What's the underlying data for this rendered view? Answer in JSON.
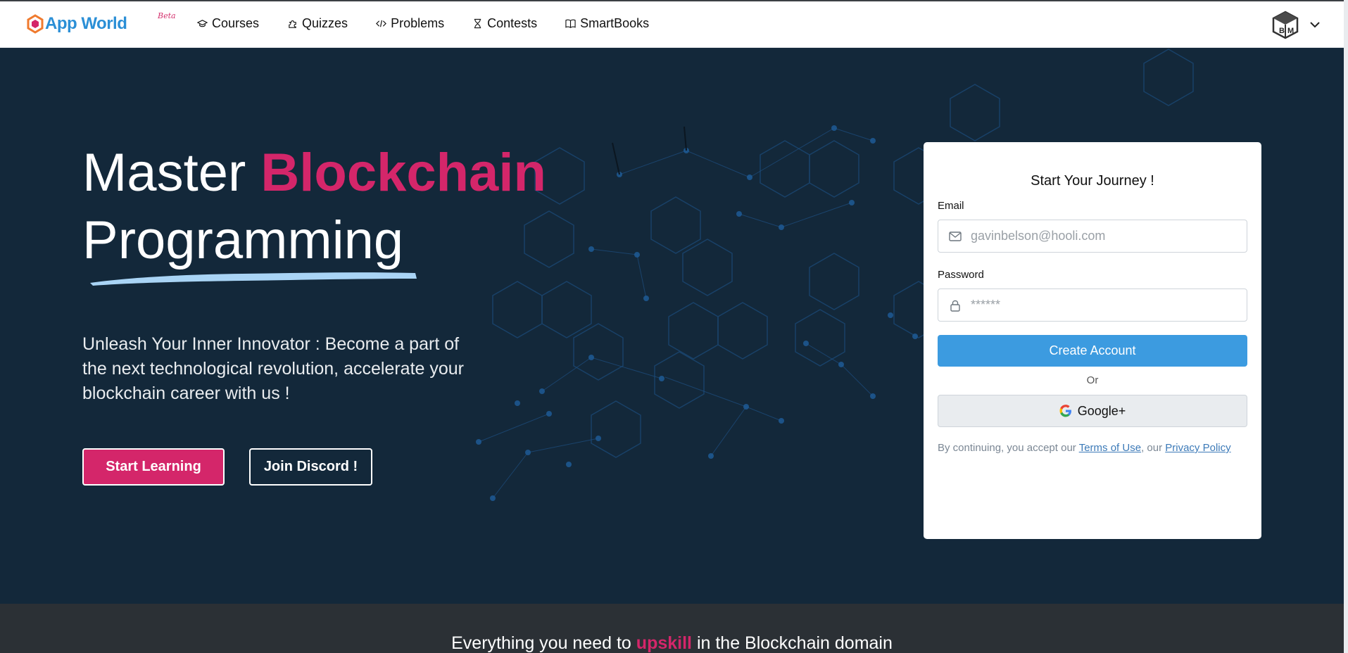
{
  "brand": {
    "name": "App World",
    "badge": "Beta",
    "accent": "#d4266a",
    "primary": "#3c9be0"
  },
  "nav": {
    "items": [
      {
        "label": "Courses",
        "icon": "graduation-cap-icon"
      },
      {
        "label": "Quizzes",
        "icon": "puzzle-icon"
      },
      {
        "label": "Problems",
        "icon": "code-icon"
      },
      {
        "label": "Contests",
        "icon": "hourglass-icon"
      },
      {
        "label": "SmartBooks",
        "icon": "book-icon"
      }
    ],
    "avatar_initials": "BM"
  },
  "hero": {
    "title_plain": "Master",
    "title_highlight": "Blockchain",
    "title_line2": "Programming",
    "subtitle": "Unleash Your Inner Innovator : Become a part of the next technological revolution, accelerate your blockchain career with us !",
    "primary_button": "Start Learning",
    "secondary_button": "Join Discord !"
  },
  "signup": {
    "title": "Start Your Journey !",
    "email_label": "Email",
    "email_placeholder": "gavinbelson@hooli.com",
    "password_label": "Password",
    "password_placeholder": "******",
    "create_button": "Create Account",
    "or_text": "Or",
    "google_button": "Google+",
    "terms_prefix": "By continuing, you accept our",
    "terms_link": "Terms of Use",
    "terms_mid": ", our",
    "privacy_link": "Privacy Policy"
  },
  "section": {
    "prefix": "Everything you need to",
    "highlight": "upskill",
    "suffix": "in the Blockchain domain"
  }
}
